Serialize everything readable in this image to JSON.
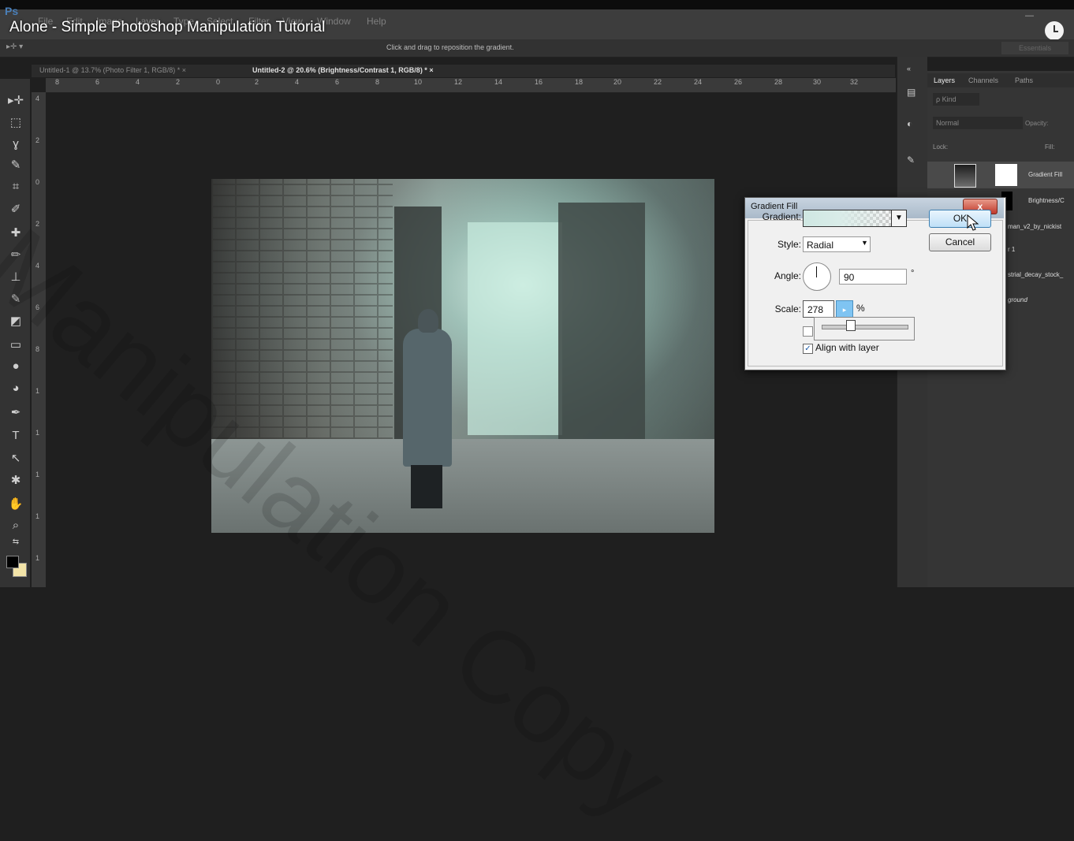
{
  "video": {
    "title": "Alone - Simple Photoshop Manipulation Tutorial"
  },
  "app": {
    "logo": "Ps",
    "menu": [
      "File",
      "Edit",
      "Image",
      "Layer",
      "Type",
      "Select",
      "Filter",
      "View",
      "Window",
      "Help"
    ],
    "options_hint": "Click and drag to reposition the gradient.",
    "workspace": "Essentials"
  },
  "tabs": [
    {
      "label": "Untitled-1 @ 13.7% (Photo Filter 1, RGB/8) *  ×"
    },
    {
      "label": "Untitled-2 @ 20.6% (Brightness/Contrast 1, RGB/8) *  ×"
    }
  ],
  "ruler": {
    "h": [
      "8",
      "6",
      "4",
      "2",
      "0",
      "2",
      "4",
      "6",
      "8",
      "10",
      "12",
      "14",
      "16",
      "18",
      "20",
      "22",
      "24",
      "26",
      "28",
      "30",
      "32"
    ],
    "v": [
      "4",
      "2",
      "0",
      "2",
      "4",
      "6",
      "8",
      "1",
      "1",
      "1",
      "1",
      "1",
      "1"
    ]
  },
  "layers_panel": {
    "tabs": [
      "Layers",
      "Channels",
      "Paths"
    ],
    "kind": "ρ Kind",
    "blend_mode": "Normal",
    "opacity_label": "Opacity:",
    "lock_label": "Lock:",
    "fill_label": "Fill:",
    "layers": [
      "Gradient Fill",
      "Brightness/C",
      "man_v2_by_nickist",
      "r 1",
      "strial_decay_stock_",
      "ground"
    ]
  },
  "dialog": {
    "title": "Gradient Fill",
    "close": "x",
    "gradient_label": "Gradient:",
    "style_label": "Style:",
    "style_value": "Radial",
    "angle_label": "Angle:",
    "angle_value": "90",
    "angle_unit": "°",
    "scale_label": "Scale:",
    "scale_value": "278",
    "scale_unit": "%",
    "scale_slider_fraction": 0.34,
    "align_label": "Align with layer",
    "align_checked": true,
    "ok": "OK",
    "cancel": "Cancel"
  },
  "watermark": "Manipulation Copy",
  "colors": {
    "foreground": "#000000",
    "background": "#f3e4a8",
    "accent": "#7fc4f2"
  }
}
